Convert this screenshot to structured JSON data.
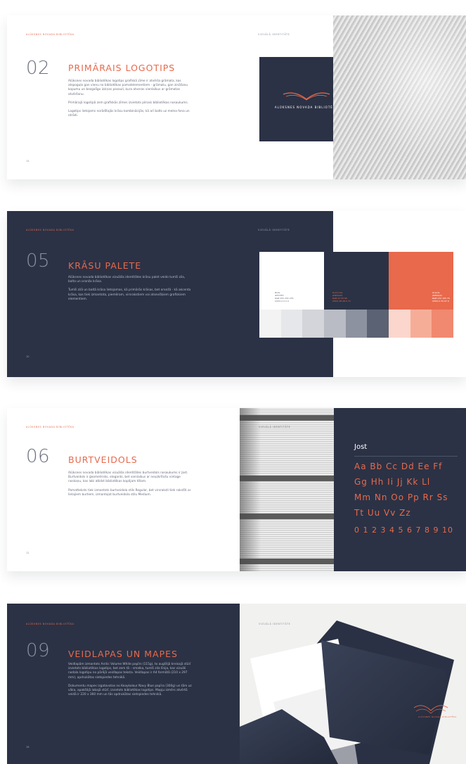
{
  "spreads": {
    "primary_logo": {
      "library_name": "Alūksnes novada bibliotēka",
      "section_label": "Vizuālā identitāte",
      "number": "02",
      "title": "PRIMĀRAIS LOGOTIPS",
      "paragraphs": [
        "Alūksnes novada bibliotēkas logotips grafiskā zīme ir atvērta grāmata, kas atspoguļo gan vienu no bibliotēkas pamatelementiem - grāmatu, gan zināšanu kopumu un bezgalīgo izziņas pasauli, kura atveras vienlaikus ar grāmatas atvēršanu.",
        "Primārajā logotipā zem grafiskās zīmes izvietots pilnais bibliotēkas nosaukums.",
        "Logotips lietojams norādītajās krāsu kombinācijās, kā arī balts uz melna fona un otrādi."
      ],
      "page_number": "14",
      "logo_caption": "ALŪKSNES NOVADA BIBLIOTĒKA"
    },
    "colour_palette": {
      "library_name": "Alūksnes novada bibliotēka",
      "section_label": "Vizuālā identitāte",
      "number": "05",
      "title": "KRĀSU PALETE",
      "paragraphs": [
        "Alūksnes novada bibliotēkas vizuālās identitātes krāsu palet veido tumši zila, balta un oranža krāsa.",
        "Tumši zilā un baltā krāsa lietojamas, kā primārās krāsas, bet oranžā - kā akcenta krāsa, kas tiek izmantota, piemēram, virsrakstiem vai atsevišķiem grafiskiem elementiem."
      ],
      "page_number": "10",
      "swatches": [
        {
          "name": "Balts",
          "hex": "#FFFFFF",
          "rgb": "RGB 255 255 255",
          "cmyk": "CMYK 0 0 0 0",
          "color": "#ffffff"
        },
        {
          "name": "Tumši zils",
          "hex": "#2B3245",
          "rgb": "RGB 43 50 69",
          "cmyk": "CMYK 38 28 0 73",
          "color": "#2b3245"
        },
        {
          "name": "Oranžs",
          "hex": "#E8694C",
          "rgb": "RGB 232 105 76",
          "cmyk": "CMYK 0 55 67 9",
          "color": "#e8694c"
        }
      ],
      "shades": [
        "#f3f3f4",
        "#e6e7ea",
        "#d3d5da",
        "#b9bcc4",
        "#8d92a0",
        "#5b6273",
        "#fbd6cc",
        "#f6ad98",
        "#f0896f"
      ]
    },
    "typeface": {
      "library_name": "Alūksnes novada bibliotēka",
      "section_label": "Vizuālā identitāte",
      "number": "06",
      "title": "BURTVEIDOLS",
      "paragraphs": [
        "Alūksnes novada bibliotēkas vizuālās identitātes burtveidols nosaukums ir Jost. Burtveidols ir ģeometrisks, elegants, bet vienlaikus ar neuzkrītošu vintage noskaņu, kas labi atbilst bibliotēkas kopējam tēlam.",
        "Pamatteksts tiek izmantots burtveidola stils Regular, bet virsraksti tiek rakstīti ar lielajiem burtiem, izmantojot burtveidola stilu Medium."
      ],
      "page_number": "12",
      "font_name": "Jost",
      "alphabet_rows": [
        "Aa  Bb  Cc  Dd  Ee  Ff",
        "Gg  Hh  Ii  Jj  Kk  Ll",
        "Mm  Nn  Oo  Pp  Rr  Ss",
        "Tt  Uu  Vv  Zz"
      ],
      "numbers": "0 1 2 3 4 5 6 7 8 9 10"
    },
    "letterheads": {
      "library_name": "Alūksnes novada bibliotēka",
      "section_label": "Vizuālā identitāte",
      "number": "09",
      "title": "VEIDLAPAS UN MAPES",
      "paragraphs": [
        "Veidlapām izmantots Arctic Volume White papīrs (115g), to augšējā kreisajā stūrī izvietots bibliotēkas logotips, bet zem tā – smalka, tumši zila līnija, kas vizuāli nodala logotipu no pārējā veidlapas teksta. Veidlapas ir A4 formātā (210 x 297 mm), apdrukātas sietspiedes tehnikā.",
        "Dokumentu mapes izgatavotas no Keaykolour Navy Blue papīra (300g) un tām uz vāka, apakšējā labajā stūrī, izvietots bibliotēkas logotips. Mapju izmērs atvērtā veidā ir 220 x 360 mm un tās apdrukātas sietspiedes tehnikā."
      ],
      "page_number": "16",
      "folder_logo_text": "ALŪKSNES NOVADA BIBLIOTĒKA"
    }
  },
  "colors": {
    "navy": "#2b3245",
    "orange": "#e8694c",
    "white": "#ffffff"
  }
}
